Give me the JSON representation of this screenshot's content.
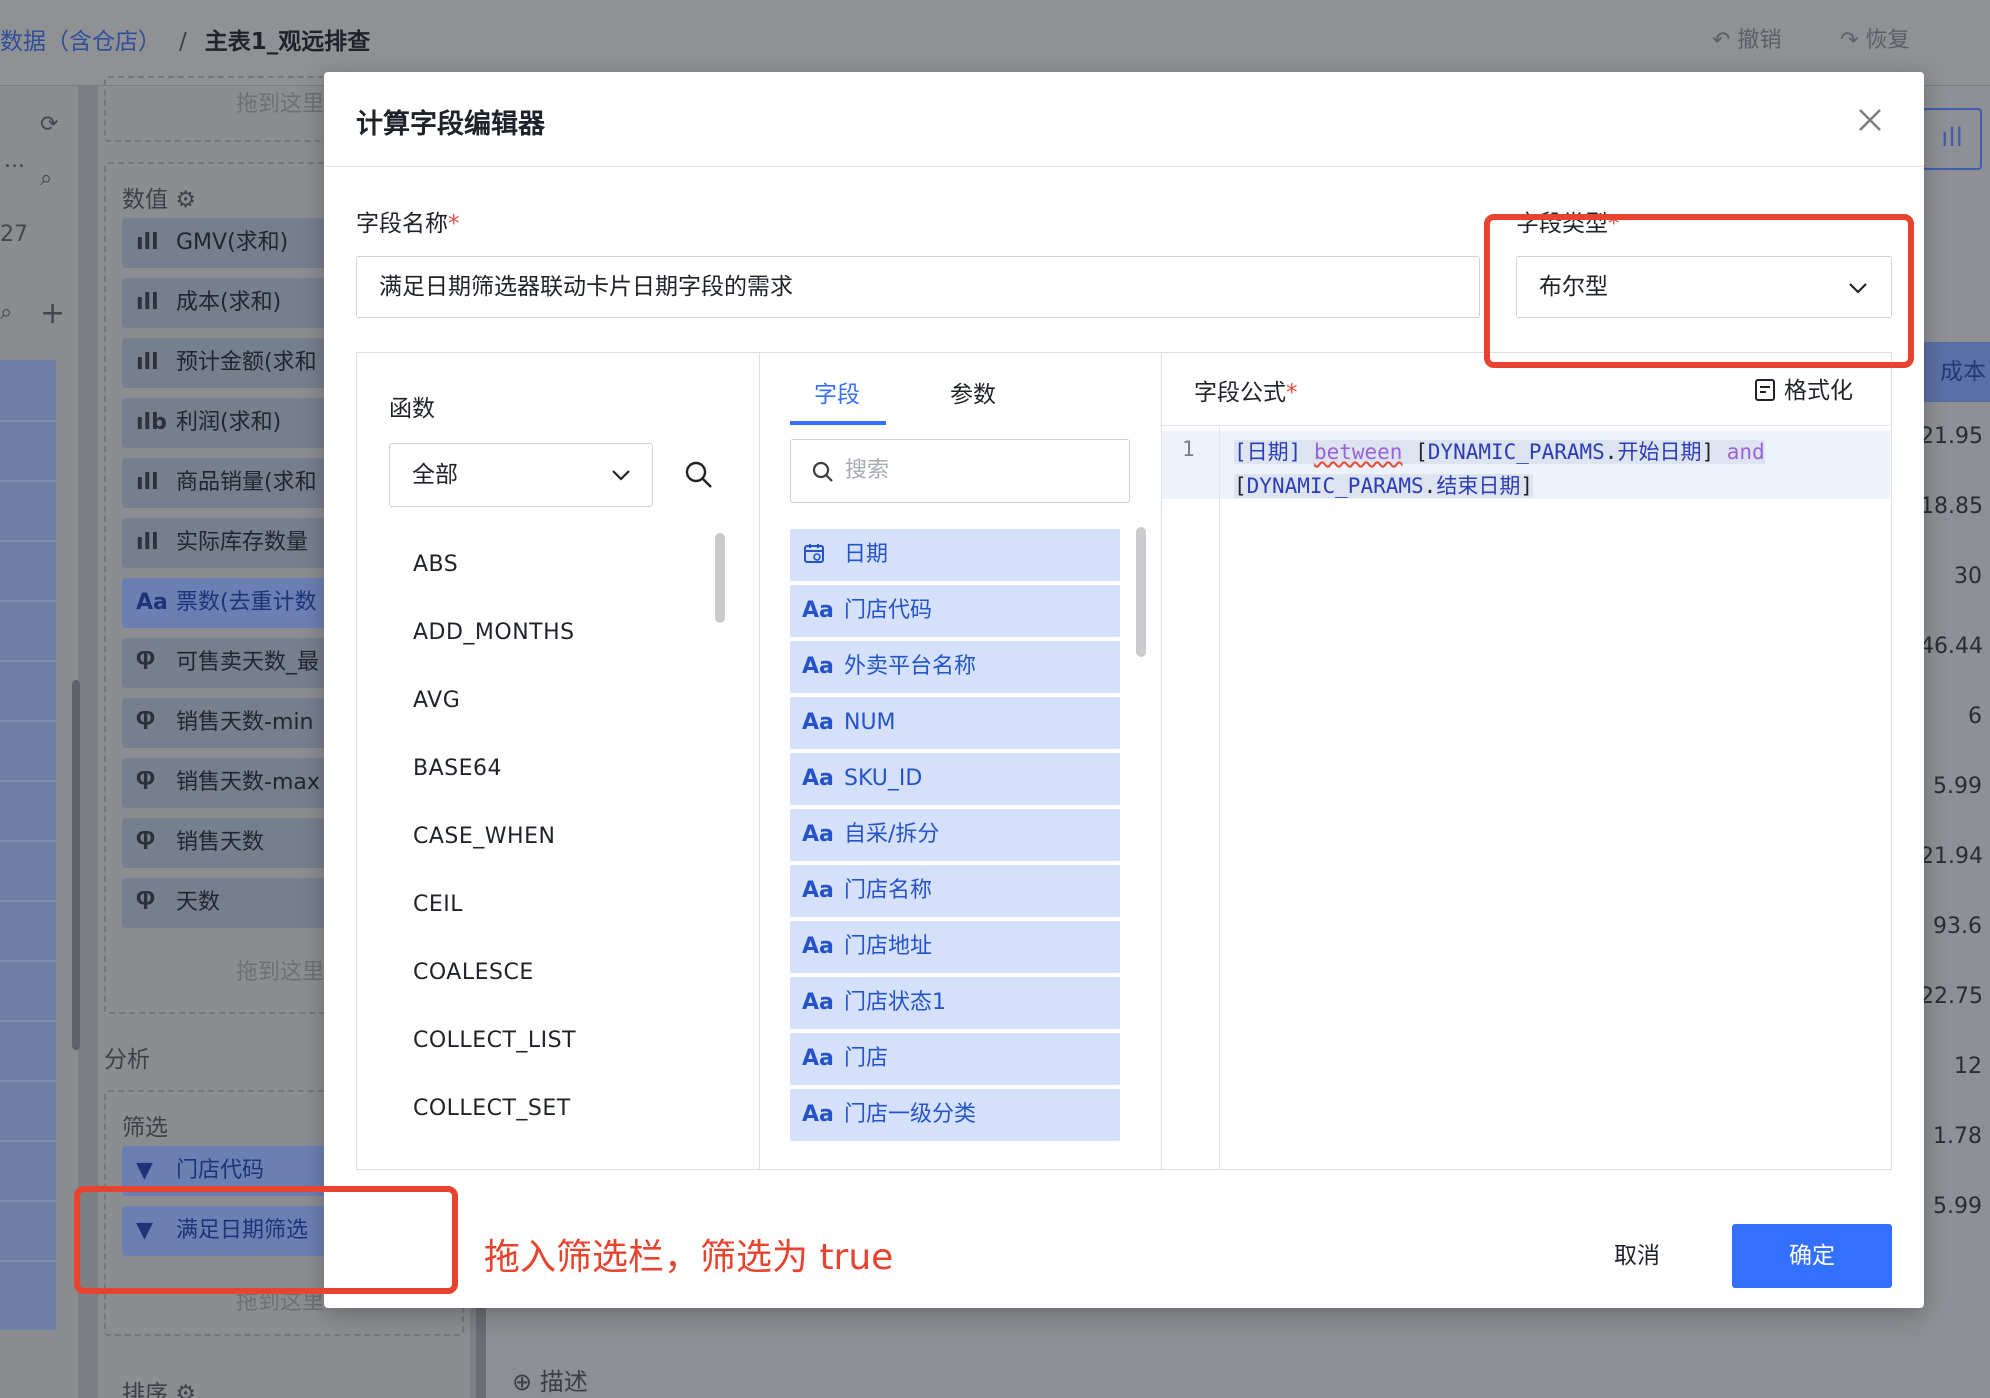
{
  "background": {
    "breadcrumb": {
      "dataset": "数据（含仓店）",
      "separator": "/",
      "sheet": "主表1_观远排查"
    },
    "undo_label": "撤销",
    "redo_label": "恢复",
    "side_numbers": {
      "dots": "...",
      "num": "27"
    },
    "drop_hint": "拖到这里",
    "values_section": "数值",
    "measures": [
      {
        "icon": "bar-chart-icon",
        "glyph": "ıll",
        "label": "GMV(求和)"
      },
      {
        "icon": "bar-chart-icon",
        "glyph": "ıll",
        "label": "成本(求和)"
      },
      {
        "icon": "bar-chart-icon",
        "glyph": "ıll",
        "label": "预计金额(求和"
      },
      {
        "icon": "bar-chart-calc-icon",
        "glyph": "ılb",
        "label": "利润(求和)"
      },
      {
        "icon": "bar-chart-icon",
        "glyph": "ıll",
        "label": "商品销量(求和"
      },
      {
        "icon": "bar-chart-icon",
        "glyph": "ıll",
        "label": "实际库存数量"
      },
      {
        "icon": "text-type-icon",
        "glyph": "Aa",
        "label": "票数(去重计数"
      },
      {
        "icon": "calc-field-icon",
        "glyph": "Ⴔ",
        "label": "可售卖天数_最"
      },
      {
        "icon": "calc-field-icon",
        "glyph": "Ⴔ",
        "label": "销售天数-min"
      },
      {
        "icon": "calc-field-icon",
        "glyph": "Ⴔ",
        "label": "销售天数-max"
      },
      {
        "icon": "calc-field-icon",
        "glyph": "Ⴔ",
        "label": "销售天数"
      },
      {
        "icon": "calc-field-icon",
        "glyph": "Ⴔ",
        "label": "天数"
      }
    ],
    "analysis_section": "分析",
    "filter_section": "筛选",
    "filters": [
      {
        "label": "门店代码"
      },
      {
        "label": "满足日期筛选"
      }
    ],
    "sort_section": "排序",
    "right_header": "成本",
    "right_values": [
      "21.95",
      "18.85",
      "30",
      "46.44",
      "6",
      "5.99",
      "21.94",
      "93.6",
      "22.75",
      "12",
      "1.78",
      "5.99"
    ],
    "description_label": "描述"
  },
  "dialog": {
    "title": "计算字段编辑器",
    "field_name_label": "字段名称",
    "required_mark": "*",
    "field_name_value": "满足日期筛选器联动卡片日期字段的需求",
    "field_type_label": "字段类型",
    "field_type_value": "布尔型",
    "functions": {
      "title": "函数",
      "category": "全部",
      "items": [
        "ABS",
        "ADD_MONTHS",
        "AVG",
        "BASE64",
        "CASE_WHEN",
        "CEIL",
        "COALESCE",
        "COLLECT_LIST",
        "COLLECT_SET"
      ]
    },
    "fields": {
      "tabs": [
        "字段",
        "参数"
      ],
      "active_tab": "字段",
      "search_placeholder": "搜索",
      "items": [
        {
          "type_icon": "calendar-icon",
          "type_glyph": "📅",
          "name": "日期"
        },
        {
          "type_icon": "text-type-icon",
          "type_glyph": "Aa",
          "name": "门店代码"
        },
        {
          "type_icon": "text-type-icon",
          "type_glyph": "Aa",
          "name": "外卖平台名称"
        },
        {
          "type_icon": "text-type-icon",
          "type_glyph": "Aa",
          "name": "NUM"
        },
        {
          "type_icon": "text-type-icon",
          "type_glyph": "Aa",
          "name": "SKU_ID"
        },
        {
          "type_icon": "text-type-icon",
          "type_glyph": "Aa",
          "name": "自采/拆分"
        },
        {
          "type_icon": "text-type-icon",
          "type_glyph": "Aa",
          "name": "门店名称"
        },
        {
          "type_icon": "text-type-icon",
          "type_glyph": "Aa",
          "name": "门店地址"
        },
        {
          "type_icon": "text-type-icon",
          "type_glyph": "Aa",
          "name": "门店状态1"
        },
        {
          "type_icon": "text-type-icon",
          "type_glyph": "Aa",
          "name": "门店"
        },
        {
          "type_icon": "text-type-icon",
          "type_glyph": "Aa",
          "name": "门店一级分类"
        }
      ]
    },
    "formula": {
      "label": "字段公式",
      "format_label": "格式化",
      "line_number": "1",
      "tokens": {
        "f1": "[日期]",
        "kw1": "between",
        "p1_open": "[",
        "p1_ns": "DYNAMIC_PARAMS",
        "p1_dot": ".",
        "p1_name": "开始日期",
        "p1_close": "]",
        "kw2": "and",
        "p2_open": "[",
        "p2_ns": "DYNAMIC_PARAMS",
        "p2_dot": ".",
        "p2_name": "结束日期",
        "p2_close": "]"
      }
    },
    "cancel_label": "取消",
    "ok_label": "确定"
  },
  "annotation": {
    "text": "拖入筛选栏，筛选为 true",
    "color": "#e8432e"
  },
  "colors": {
    "accent": "#3370ff",
    "field_chip": "#d5e1fb",
    "annotation": "#e8432e"
  }
}
